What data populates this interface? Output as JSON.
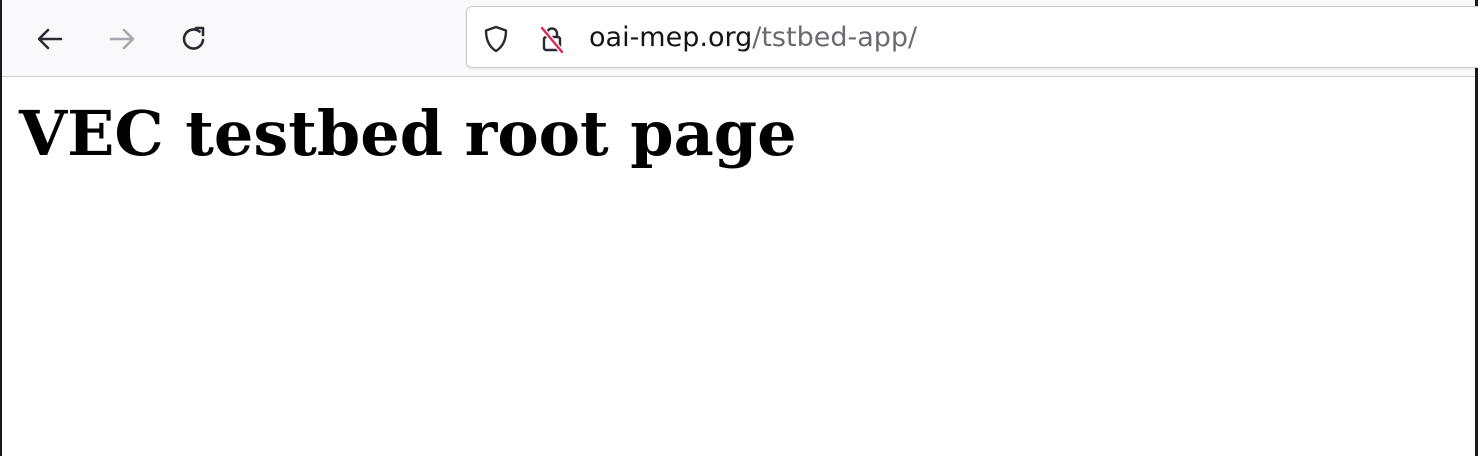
{
  "browser": {
    "back_icon": "arrow-left-icon",
    "forward_icon": "arrow-right-icon",
    "reload_icon": "reload-icon",
    "urlbar": {
      "security_icon": "shield-icon",
      "connection_icon": "insecure-lock-icon",
      "host": "oai-mep.org",
      "path": "/tstbed-app/"
    }
  },
  "page": {
    "heading": "VEC testbed root page"
  },
  "colors": {
    "toolbar_bg": "#f9f9fb",
    "insecure_strike": "#e22850",
    "url_path": "#6a6a72"
  }
}
